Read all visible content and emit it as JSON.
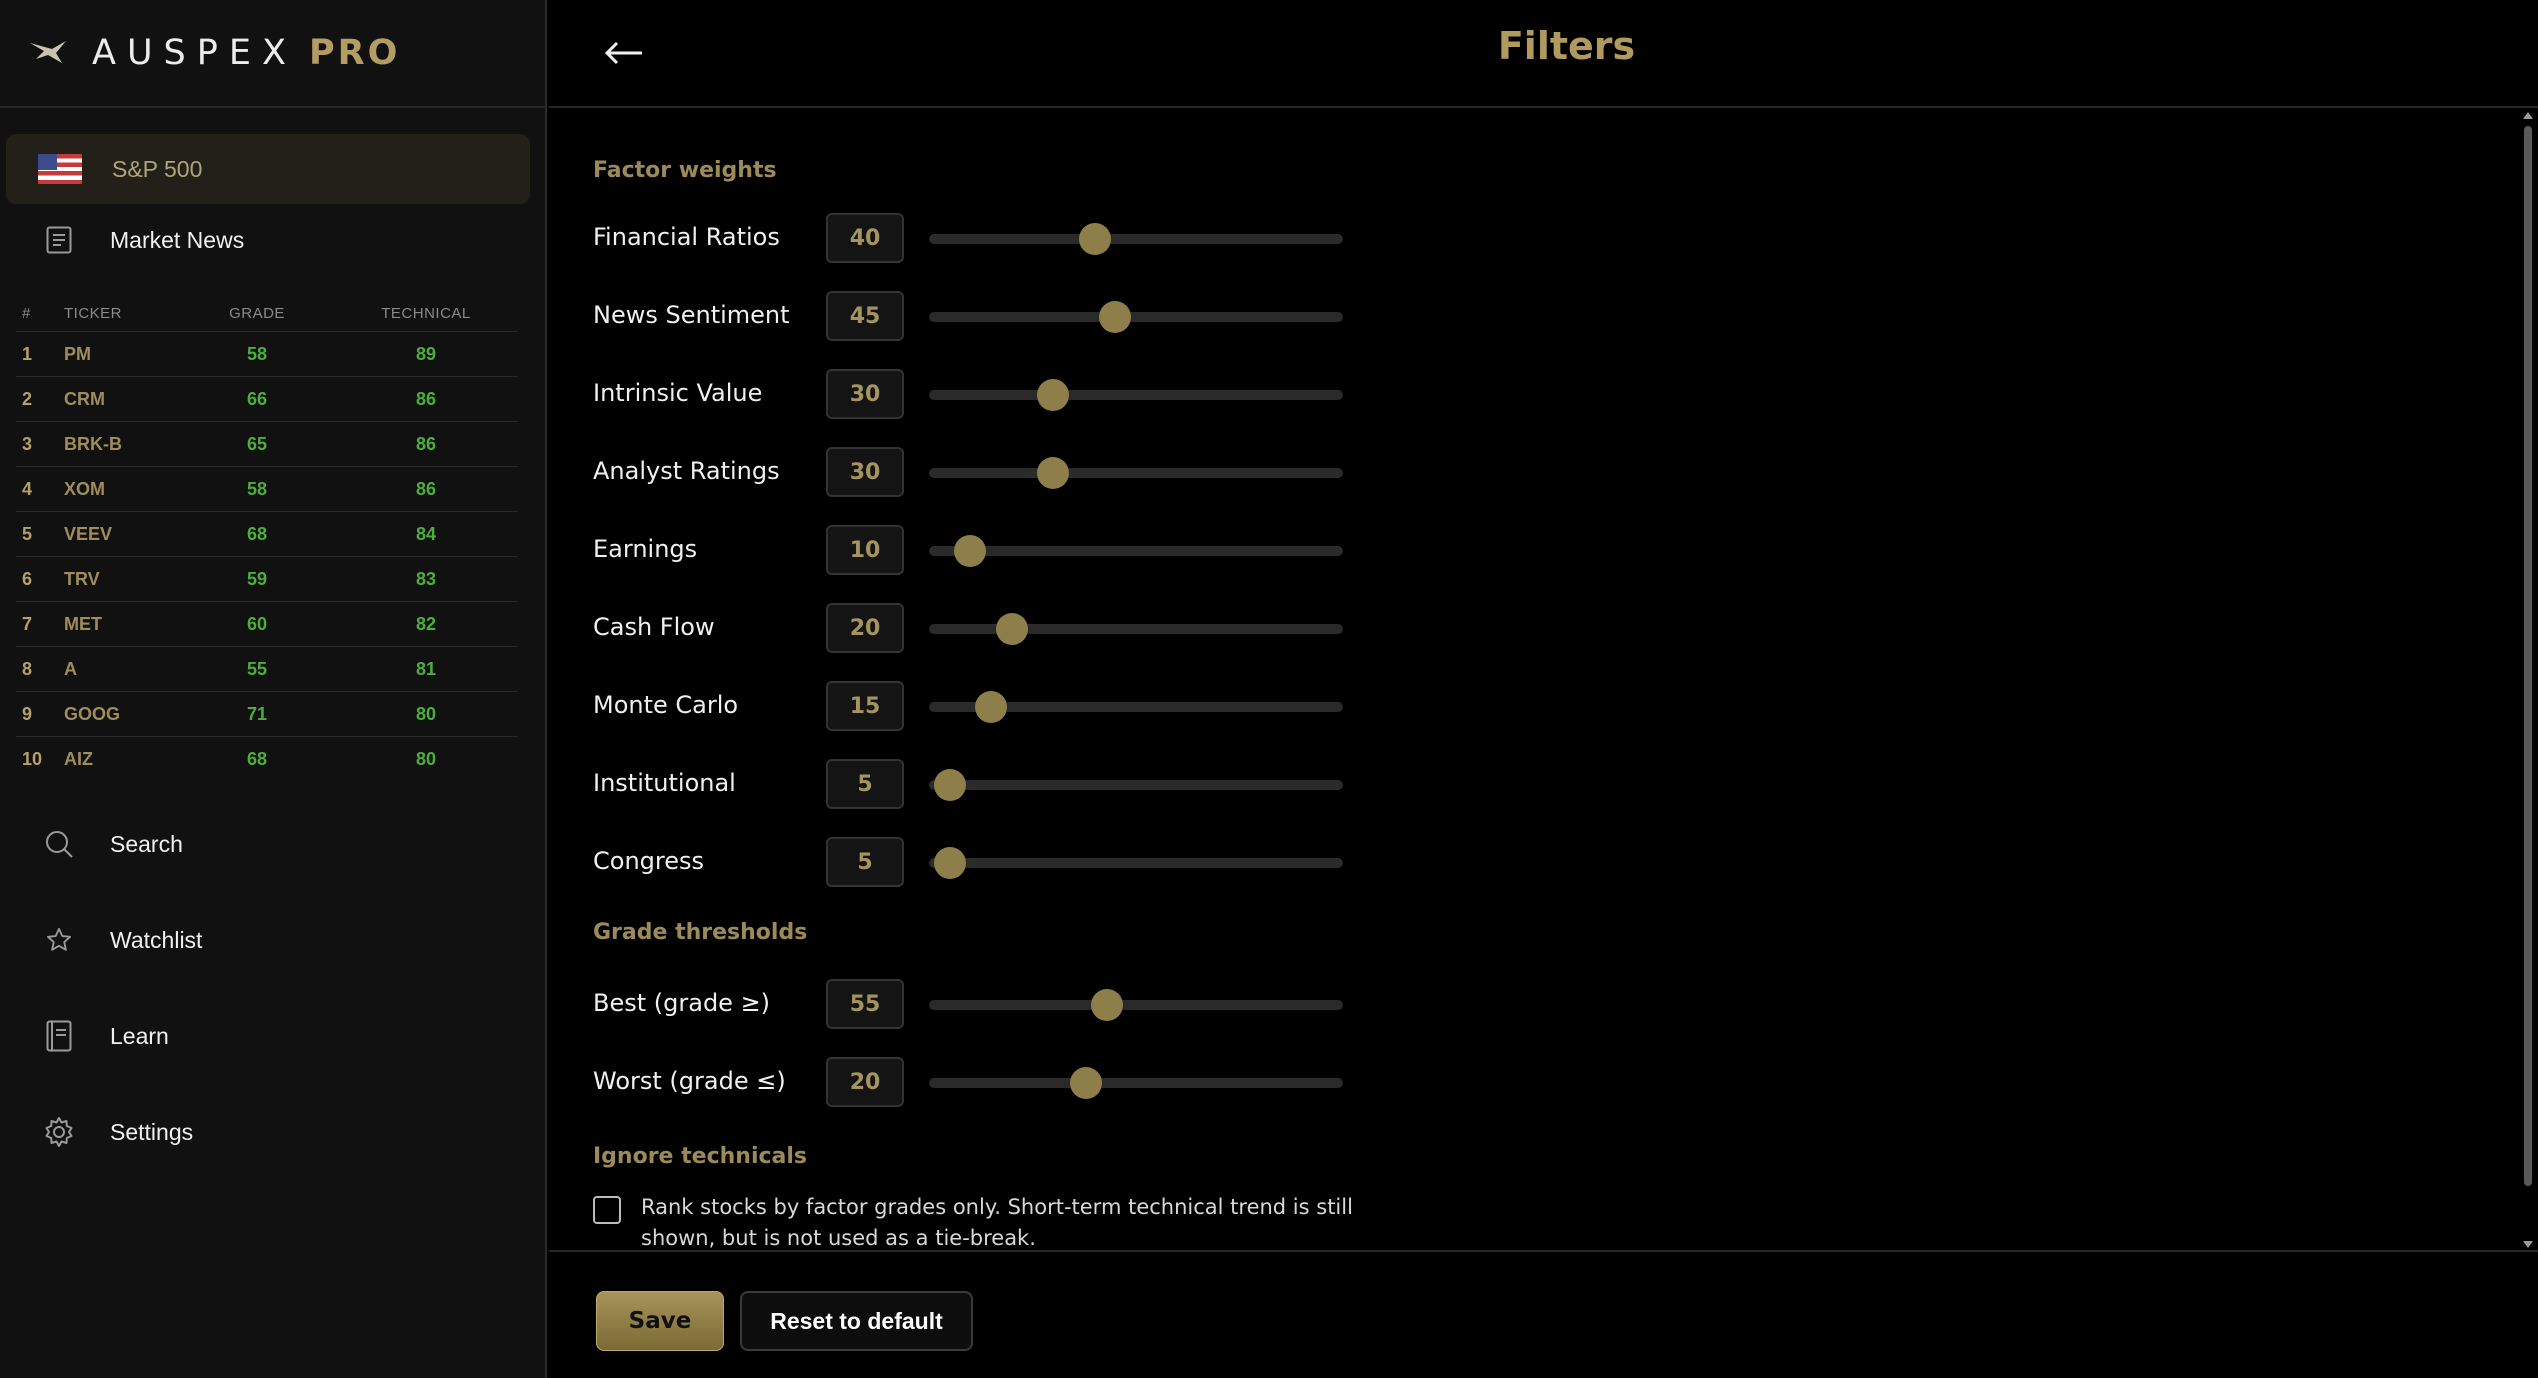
{
  "brand": {
    "name": "AUSPEX",
    "suffix": "PRO"
  },
  "sidebar": {
    "market": {
      "label": "S&P 500",
      "icon": "us-flag-icon"
    },
    "market_news": {
      "label": "Market News",
      "icon": "news-icon"
    },
    "table": {
      "headers": {
        "num": "#",
        "ticker": "TICKER",
        "grade": "GRADE",
        "technical": "TECHNICAL"
      },
      "rows": [
        {
          "num": "1",
          "ticker": "PM",
          "grade": "58",
          "technical": "89"
        },
        {
          "num": "2",
          "ticker": "CRM",
          "grade": "66",
          "technical": "86"
        },
        {
          "num": "3",
          "ticker": "BRK-B",
          "grade": "65",
          "technical": "86"
        },
        {
          "num": "4",
          "ticker": "XOM",
          "grade": "58",
          "technical": "86"
        },
        {
          "num": "5",
          "ticker": "VEEV",
          "grade": "68",
          "technical": "84"
        },
        {
          "num": "6",
          "ticker": "TRV",
          "grade": "59",
          "technical": "83"
        },
        {
          "num": "7",
          "ticker": "MET",
          "grade": "60",
          "technical": "82"
        },
        {
          "num": "8",
          "ticker": "A",
          "grade": "55",
          "technical": "81"
        },
        {
          "num": "9",
          "ticker": "GOOG",
          "grade": "71",
          "technical": "80"
        },
        {
          "num": "10",
          "ticker": "AIZ",
          "grade": "68",
          "technical": "80"
        }
      ]
    },
    "nav": {
      "search": {
        "label": "Search",
        "icon": "search-icon"
      },
      "watchlist": {
        "label": "Watchlist",
        "icon": "star-icon"
      },
      "learn": {
        "label": "Learn",
        "icon": "book-icon"
      },
      "settings": {
        "label": "Settings",
        "icon": "gear-icon"
      }
    }
  },
  "header": {
    "title": "Filters",
    "back_icon": "back-arrow-icon"
  },
  "filters": {
    "factor_weights_title": "Factor weights",
    "factor_weights": [
      {
        "label": "Financial Ratios",
        "value": "40",
        "fraction": 0.4
      },
      {
        "label": "News Sentiment",
        "value": "45",
        "fraction": 0.45
      },
      {
        "label": "Intrinsic Value",
        "value": "30",
        "fraction": 0.3
      },
      {
        "label": "Analyst Ratings",
        "value": "30",
        "fraction": 0.3
      },
      {
        "label": "Earnings",
        "value": "10",
        "fraction": 0.1
      },
      {
        "label": "Cash Flow",
        "value": "20",
        "fraction": 0.2
      },
      {
        "label": "Monte Carlo",
        "value": "15",
        "fraction": 0.15
      },
      {
        "label": "Institutional",
        "value": "5",
        "fraction": 0.05
      },
      {
        "label": "Congress",
        "value": "5",
        "fraction": 0.05
      }
    ],
    "grade_thresholds_title": "Grade thresholds",
    "grade_thresholds": [
      {
        "label": "Best (grade ≥)",
        "value": "55",
        "fraction": 0.43
      },
      {
        "label": "Worst (grade ≤)",
        "value": "20",
        "fraction": 0.38
      }
    ],
    "ignore_technicals_title": "Ignore technicals",
    "ignore_technicals_text": "Rank stocks by factor grades only. Short-term technical trend is still shown, but is not used as a tie-break.",
    "ignore_technicals_checked": false
  },
  "footer": {
    "save_label": "Save",
    "reset_label": "Reset to default"
  },
  "colors": {
    "accent": "#b09a5e",
    "thumb": "#8e7e4a",
    "positive": "#4caf3c",
    "background": "#000000",
    "sidebar": "#111111"
  }
}
